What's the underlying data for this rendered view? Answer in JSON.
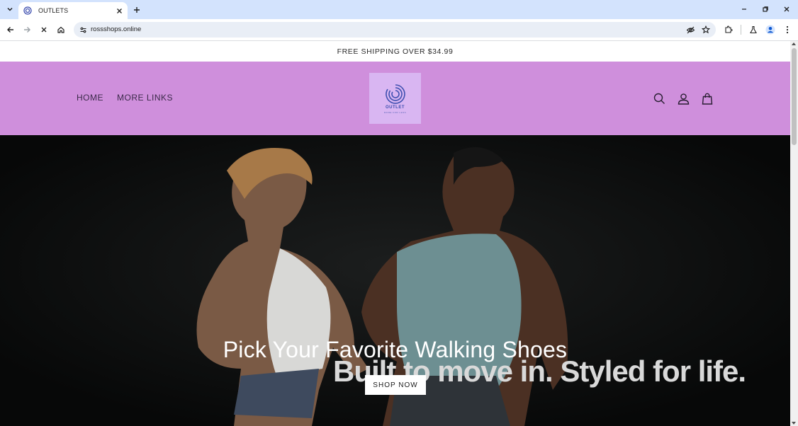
{
  "browser": {
    "tab": {
      "title": "OUTLETS",
      "favicon": "outlet-favicon"
    },
    "address": {
      "url": "rossshops.online"
    },
    "icons": {
      "tab_list": "chevron-down-icon",
      "close_tab": "close-icon",
      "new_tab": "plus-icon",
      "minimize": "minimize-icon",
      "restore": "restore-icon",
      "close_window": "close-icon",
      "back": "back-arrow-icon",
      "forward": "forward-arrow-icon",
      "stop": "stop-loading-icon",
      "home": "home-icon",
      "site_info": "tune-icon",
      "hide": "eye-off-icon",
      "bookmark": "star-icon",
      "extensions": "puzzle-icon",
      "labs": "flask-icon",
      "profile": "profile-icon",
      "menu": "kebab-menu-icon"
    },
    "colors": {
      "tabbar": "#d3e3fd",
      "omnibox": "#e9eef6"
    }
  },
  "page": {
    "announcement": "FREE SHIPPING OVER $34.99",
    "nav": {
      "home": "HOME",
      "more_links": "MORE LINKS"
    },
    "logo": {
      "name": "OUTLET",
      "tagline": "MORE FOR LESS"
    },
    "header_icons": {
      "search": "search-icon",
      "account": "user-icon",
      "cart": "shopping-bag-icon"
    },
    "hero": {
      "heading": "Pick Your Favorite Walking Shoes",
      "tagline": "Built to move in. Styled for life.",
      "cta": "SHOP NOW"
    },
    "colors": {
      "header": "#cf8fdc",
      "logo_bg": "#d9b6f2",
      "hero_bg": "#0b0c0c"
    }
  }
}
